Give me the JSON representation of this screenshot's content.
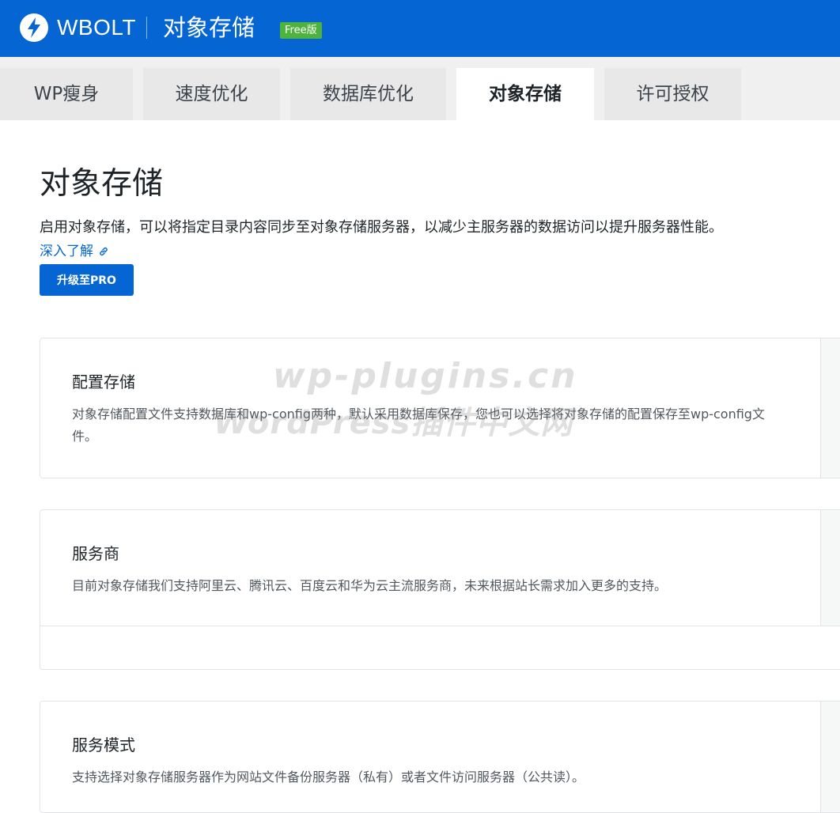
{
  "header": {
    "brand": "WBOLT",
    "title": "对象存储",
    "badge": "Free版"
  },
  "tabs": [
    {
      "label": "WP瘦身",
      "active": false
    },
    {
      "label": "速度优化",
      "active": false
    },
    {
      "label": "数据库优化",
      "active": false
    },
    {
      "label": "对象存储",
      "active": true
    },
    {
      "label": "许可授权",
      "active": false
    }
  ],
  "main": {
    "title": "对象存储",
    "description": "启用对象存储，可以将指定目录内容同步至对象存储服务器，以减少主服务器的数据访问以提升服务器性能。",
    "learn_more": "深入了解",
    "upgrade_button": "升级至PRO"
  },
  "sections": [
    {
      "title": "配置存储",
      "description": "对象存储配置文件支持数据库和wp-config两种，默认采用数据库保存，您也可以选择将对象存储的配置保存至wp-config文件。"
    },
    {
      "title": "服务商",
      "description": "目前对象存储我们支持阿里云、腾讯云、百度云和华为云主流服务商，未来根据站长需求加入更多的支持。"
    },
    {
      "title": "服务模式",
      "description": "支持选择对象存储服务器作为网站文件备份服务器（私有）或者文件访问服务器（公共读）。"
    }
  ],
  "watermark": {
    "line1": "wp-plugins.cn",
    "line2": "WordPress插件中文网"
  },
  "colors": {
    "brand_blue": "#0566d3",
    "badge_green": "#4db33d"
  }
}
